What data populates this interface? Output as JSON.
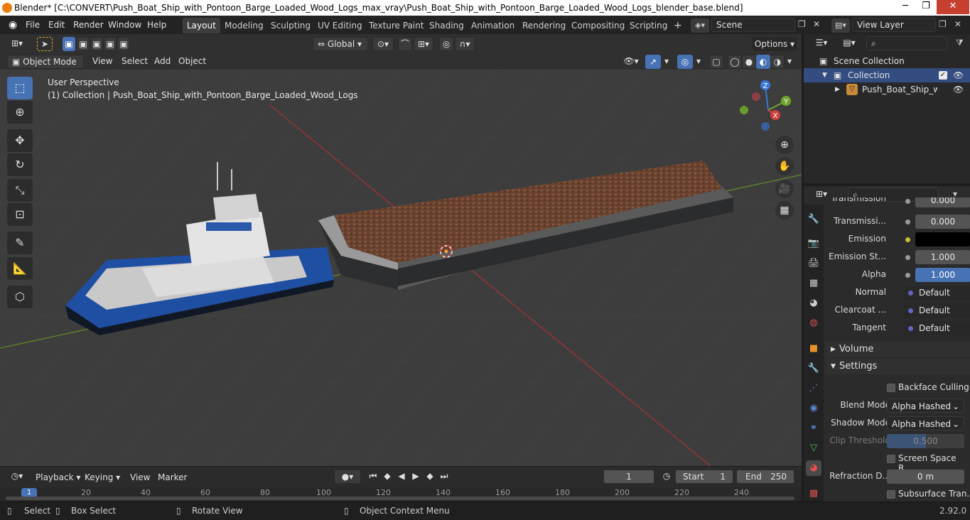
{
  "window": {
    "title": "Blender* [C:\\CONVERT\\Push_Boat_Ship_with_Pontoon_Barge_Loaded_Wood_Logs_max_vray\\Push_Boat_Ship_with_Pontoon_Barge_Loaded_Wood_Logs_blender_base.blend]",
    "minimize": "─",
    "maximize": "❐",
    "close": "✕"
  },
  "menubar": {
    "items": [
      "File",
      "Edit",
      "Render",
      "Window",
      "Help"
    ]
  },
  "workspaces": {
    "tabs": [
      "Layout",
      "Modeling",
      "Sculpting",
      "UV Editing",
      "Texture Paint",
      "Shading",
      "Animation",
      "Rendering",
      "Compositing",
      "Scripting"
    ],
    "active": "Layout",
    "add": "+"
  },
  "scene": {
    "label": "Scene",
    "viewlayer": "View Layer"
  },
  "toolheader": {
    "orientation": "Global",
    "options": "Options"
  },
  "viewheader": {
    "mode": "Object Mode",
    "menus": [
      "View",
      "Select",
      "Add",
      "Object"
    ]
  },
  "viewport": {
    "perspective": "User Perspective",
    "collection_info": "(1) Collection | Push_Boat_Ship_with_Pontoon_Barge_Loaded_Wood_Logs",
    "gizmo": {
      "z": "Z",
      "y": "Y",
      "x": "X"
    }
  },
  "timeline": {
    "menus": [
      "Playback",
      "Keying",
      "View",
      "Marker"
    ],
    "current_frame": "1",
    "start_label": "Start",
    "start": "1",
    "end_label": "End",
    "end": "250",
    "ruler": [
      "1",
      "20",
      "40",
      "60",
      "80",
      "100",
      "120",
      "140",
      "160",
      "180",
      "200",
      "220",
      "240"
    ]
  },
  "statusbar": {
    "select": "Select",
    "box_select": "Box Select",
    "rotate": "Rotate View",
    "context": "Object Context Menu",
    "version": "2.92.0"
  },
  "outliner": {
    "root": "Scene Collection",
    "collection": "Collection",
    "object": "Push_Boat_Ship_with"
  },
  "properties": {
    "rows": [
      {
        "label": "Transmission",
        "value": "0.000"
      },
      {
        "label": "Transmissi...",
        "value": "0.000"
      },
      {
        "label": "Emission",
        "value": ""
      },
      {
        "label": "Emission St...",
        "value": "1.000"
      },
      {
        "label": "Alpha",
        "value": "1.000"
      },
      {
        "label": "Normal",
        "value": "Default"
      },
      {
        "label": "Clearcoat ...",
        "value": "Default"
      },
      {
        "label": "Tangent",
        "value": "Default"
      }
    ],
    "volume": "Volume",
    "settings": "Settings",
    "backface": "Backface Culling",
    "blend_label": "Blend Mode",
    "blend": "Alpha Hashed",
    "shadow_label": "Shadow Mode",
    "shadow": "Alpha Hashed",
    "clip_label": "Clip Threshold",
    "clip": "0.500",
    "ssr": "Screen Space R...",
    "refraction_label": "Refraction D...",
    "refraction": "0 m",
    "subsurface": "Subsurface Tran..."
  },
  "colors": {
    "accent": "#4772b3",
    "boat_blue": "#1f4fa3",
    "barge_dark": "#2a2c2e",
    "logs": "#7a5036",
    "axis_red": "#b03030",
    "axis_green": "#6a9a2a"
  }
}
